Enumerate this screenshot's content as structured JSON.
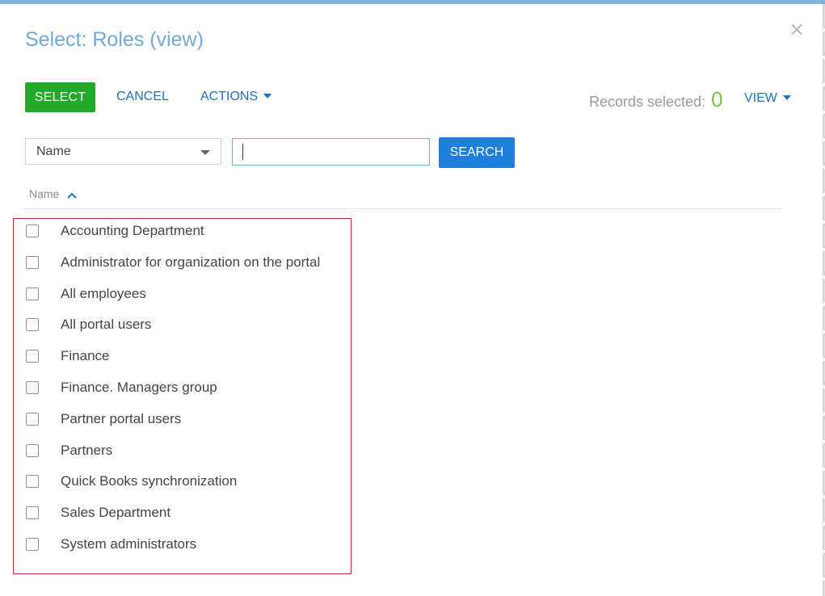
{
  "dialog": {
    "title": "Select: Roles (view)",
    "close_glyph": "×"
  },
  "toolbar": {
    "select_label": "SELECT",
    "cancel_label": "CANCEL",
    "actions_label": "ACTIONS",
    "records_label": "Records selected:",
    "records_count": "0",
    "view_label": "VIEW"
  },
  "filter": {
    "field_value": "Name",
    "search_value": "",
    "search_button": "SEARCH"
  },
  "list": {
    "column_header": "Name",
    "items": [
      {
        "label": "Accounting Department",
        "checked": false
      },
      {
        "label": "Administrator for organization on the portal",
        "checked": false
      },
      {
        "label": "All employees",
        "checked": false
      },
      {
        "label": "All portal users",
        "checked": false
      },
      {
        "label": "Finance",
        "checked": false
      },
      {
        "label": "Finance. Managers group",
        "checked": false
      },
      {
        "label": "Partner portal users",
        "checked": false
      },
      {
        "label": "Partners",
        "checked": false
      },
      {
        "label": "Quick Books synchronization",
        "checked": false
      },
      {
        "label": "Sales Department",
        "checked": false
      },
      {
        "label": "System administrators",
        "checked": false
      }
    ]
  },
  "colors": {
    "title": "#6fa8dc",
    "select_button": "#22a92a",
    "search_button": "#1f7fdd",
    "link": "#1e6fc8",
    "records_count": "#7cc344",
    "highlight_border": "#c8302f"
  }
}
